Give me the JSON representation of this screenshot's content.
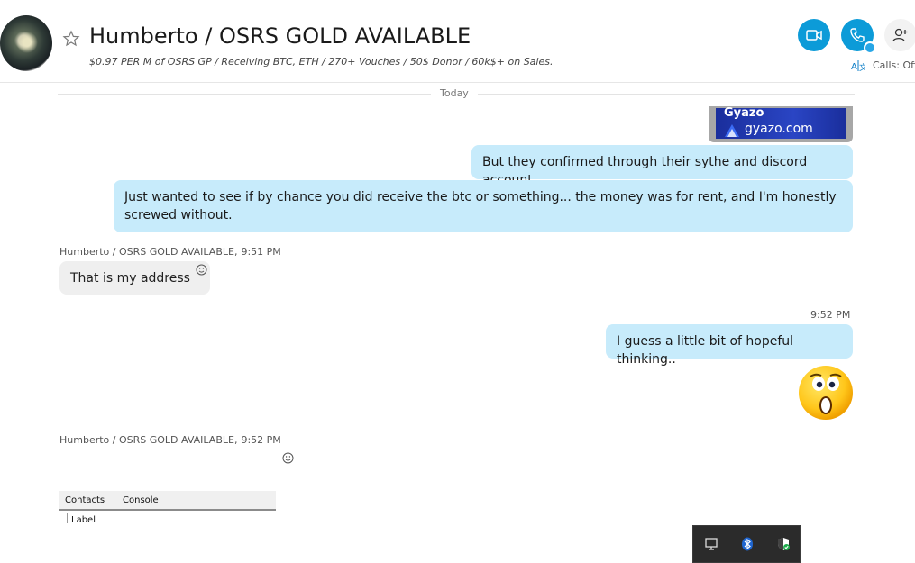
{
  "header": {
    "title": "Humberto / OSRS GOLD AVAILABLE",
    "subtitle": "$0.97 PER M of OSRS GP / Receiving BTC, ETH / 270+ Vouches / 50$ Donor / 60k$+ on Sales.",
    "calls_status": "Calls: Off"
  },
  "conversation": {
    "date_divider": "Today",
    "link_preview": {
      "brand": "Gyazo",
      "url": "gyazo.com"
    },
    "messages": [
      {
        "direction": "outgoing",
        "text": "But they confirmed through their sythe and discord account."
      },
      {
        "direction": "outgoing",
        "text": "Just wanted to see if by chance you did receive the btc or something... the money was for rent, and I'm honestly screwed without."
      },
      {
        "direction": "incoming",
        "sender": "Humberto / OSRS GOLD AVAILABLE,",
        "time": "9:51 PM",
        "text": "That is my address"
      },
      {
        "direction": "outgoing",
        "time": "9:52 PM",
        "text": "I guess a little bit of hopeful thinking.."
      },
      {
        "direction": "outgoing",
        "emoji": "astonished-emoji"
      },
      {
        "direction": "incoming",
        "sender": "Humberto / OSRS GOLD AVAILABLE,",
        "time": "9:52 PM",
        "attachment": {
          "tabs": [
            "Contacts",
            "Console"
          ],
          "field_label": "Label"
        }
      }
    ]
  },
  "tray": {
    "icons": [
      "display-icon",
      "bluetooth-icon",
      "security-shield-icon"
    ]
  },
  "colors": {
    "accent": "#0c9bd8",
    "outgoing_bubble": "#c7ebfb",
    "incoming_bubble": "#efefef",
    "tray_bg": "#2b2b2b"
  }
}
